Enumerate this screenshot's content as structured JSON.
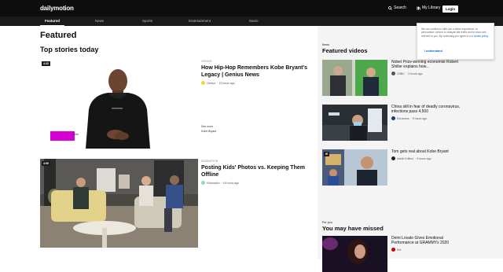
{
  "header": {
    "logo": "dailymotion",
    "search_label": "Search",
    "library_label": "My Library",
    "login_label": "Login"
  },
  "nav": {
    "tabs": [
      {
        "label": "Featured"
      },
      {
        "label": "News"
      },
      {
        "label": "Sports"
      },
      {
        "label": "Entertainment"
      },
      {
        "label": "Music"
      }
    ]
  },
  "main": {
    "title": "Featured",
    "section_title": "Top stories today",
    "stories": [
      {
        "kicker": "Genius",
        "headline": "How Hip-Hop Remembers Kobe Bryant's Legacy | Genius News",
        "channel": "Genius",
        "time": "· 13 hours ago",
        "badge": "4:32",
        "overlay_label": "Kobe",
        "more": [
          "See more",
          "Kobe Bryant"
        ]
      },
      {
        "kicker": "Kiddnation",
        "headline": "Posting Kids' Photos vs. Keeping Them Offline",
        "channel": "Kiddnation",
        "time": "· 18 hours ago",
        "badge": "4:59"
      }
    ]
  },
  "sidebar": {
    "featured_kicker": "News",
    "featured_title": "Featured videos",
    "videos": [
      {
        "title": "Nobel Prize-winning economist Robert Shiller explains how...",
        "channel": "CNBC",
        "time": "· 3 hours ago"
      },
      {
        "title": "China still in fear of deadly coronavirus, infections pass 4,500",
        "channel": "Euronews",
        "time": "· 9 hours ago"
      },
      {
        "title": "Tom gets real about Kobe Bryant",
        "channel": "Inside Edition",
        "time": "· 9 hours ago"
      }
    ],
    "missed_kicker": "For you",
    "missed_title": "You may have missed",
    "missed_video": {
      "title": "Demi Lovato Gives Emotional Performance at GRAMMYs 2020",
      "channel": "Ent"
    }
  },
  "cookie": {
    "text": "We use cookies to offer you a better experience, to personalize content, to analyze site traffic and to show ads relevant to you. By continuing you agree to our",
    "link": "cookie policy.",
    "button": "I understand"
  },
  "colors": {
    "header_bg": "#0d0d0d",
    "accent": "#0066dc",
    "overlay_magenta": "#d400d4"
  }
}
